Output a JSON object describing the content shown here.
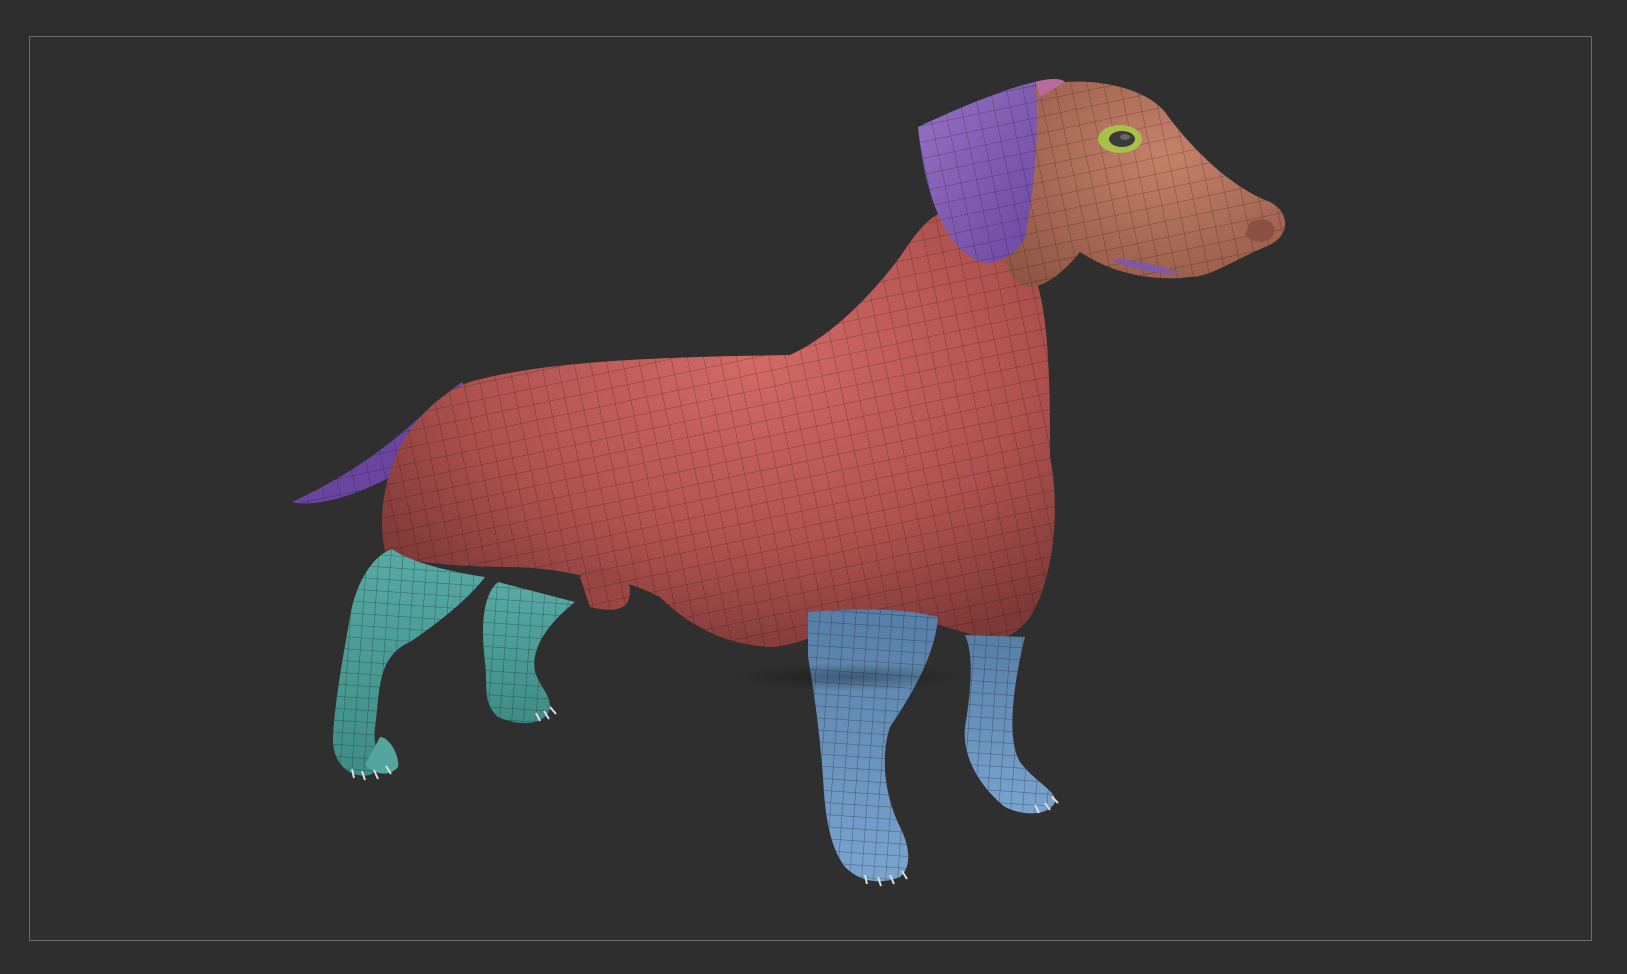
{
  "viewport": {
    "background": "#2f2f2f",
    "frame_color": "#6b6b6b"
  },
  "model": {
    "subject": "dachshund-dog-mesh",
    "wireframe_visible": true,
    "polygroup_colors": {
      "body": "#b85a57",
      "head": "#b57560",
      "ears": "#7d57a8",
      "tail": "#6a45a0",
      "hind_legs": "#4fa8a0",
      "front_legs": "#6a93bd",
      "eye_ring": "#a8c04a"
    }
  }
}
